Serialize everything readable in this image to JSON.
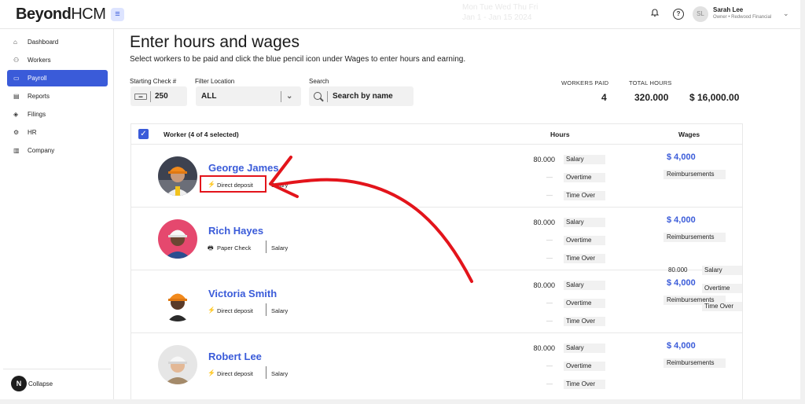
{
  "header": {
    "brand_bold": "Beyond",
    "brand_light": "HCM",
    "ghost_text_1": "Mon Tue Wed Thu Fri",
    "ghost_text_2": "Jan 1 - Jan 15 2024",
    "user": {
      "initials": "SL",
      "name": "Sarah Lee",
      "role": "Owner • Redwood Financial"
    }
  },
  "sidebar": {
    "items": [
      {
        "label": "Dashboard",
        "icon": "home-icon"
      },
      {
        "label": "Workers",
        "icon": "users-icon"
      },
      {
        "label": "Payroll",
        "icon": "payroll-icon",
        "active": true
      },
      {
        "label": "Reports",
        "icon": "reports-icon"
      },
      {
        "label": "Filings",
        "icon": "filings-icon"
      },
      {
        "label": "HR",
        "icon": "gear-icon"
      },
      {
        "label": "Company",
        "icon": "building-icon"
      }
    ],
    "collapse_initial": "N",
    "collapse_label": "Collapse"
  },
  "page": {
    "title": "Enter hours and wages",
    "subtitle": "Select workers to be paid and click the blue pencil icon under Wages to enter hours and earning."
  },
  "filters": {
    "starting_check_label": "Starting Check #",
    "starting_check_value": "250",
    "location_label": "Filter Location",
    "location_value": "ALL",
    "search_label": "Search",
    "search_placeholder": "Search by name"
  },
  "stats": {
    "workers_paid_label": "WORKERS PAID",
    "workers_paid_value": "4",
    "total_hours_label": "TOTAL HOURS",
    "total_hours_value": "320.000",
    "total_wages_value": "$ 16,000.00"
  },
  "table": {
    "worker_header": "Worker (4 of 4 selected)",
    "hours_header": "Hours",
    "wages_header": "Wages",
    "rows": [
      {
        "name": "George James",
        "pay_method": "Direct deposit",
        "pay_icon": "lightning-icon",
        "pay_type": "Salary",
        "hours": "80.000",
        "dash1": "—",
        "dash2": "—",
        "chip_salary": "Salary",
        "chip_overtime": "Overtime",
        "chip_timeover": "Time Over",
        "wage": "$ 4,000",
        "reimbursements": "Reimbursements"
      },
      {
        "name": "Rich Hayes",
        "pay_method": "Paper Check",
        "pay_icon": "printer-icon",
        "pay_type": "Salary",
        "hours": "80.000",
        "dash1": "—",
        "dash2": "—",
        "chip_salary": "Salary",
        "chip_overtime": "Overtime",
        "chip_timeover": "Time Over",
        "wage": "$ 4,000",
        "reimbursements": "Reimbursements"
      },
      {
        "name": "Victoria Smith",
        "pay_method": "Direct deposit",
        "pay_icon": "lightning-icon",
        "pay_type": "Salary",
        "hours": "80.000",
        "dash1": "—",
        "dash2": "—",
        "chip_salary": "Salary",
        "chip_overtime": "Overtime",
        "chip_timeover": "Time Over",
        "wage": "$ 4,000",
        "reimbursements": "Reimbursements"
      },
      {
        "name": "Robert Lee",
        "pay_method": "Direct deposit",
        "pay_icon": "lightning-icon",
        "pay_type": "Salary",
        "hours": "80.000",
        "dash1": "—",
        "dash2": "—",
        "chip_salary": "Salary",
        "chip_overtime": "Overtime",
        "chip_timeover": "Time Over",
        "wage": "$ 4,000",
        "reimbursements": "Reimbursements"
      }
    ],
    "overlay": {
      "hours": "80.000",
      "salary": "Salary",
      "overtime": "Overtime",
      "timeover": "Time Over"
    }
  },
  "colors": {
    "accent": "#3a5bd9",
    "annotation": "#e3141b"
  }
}
